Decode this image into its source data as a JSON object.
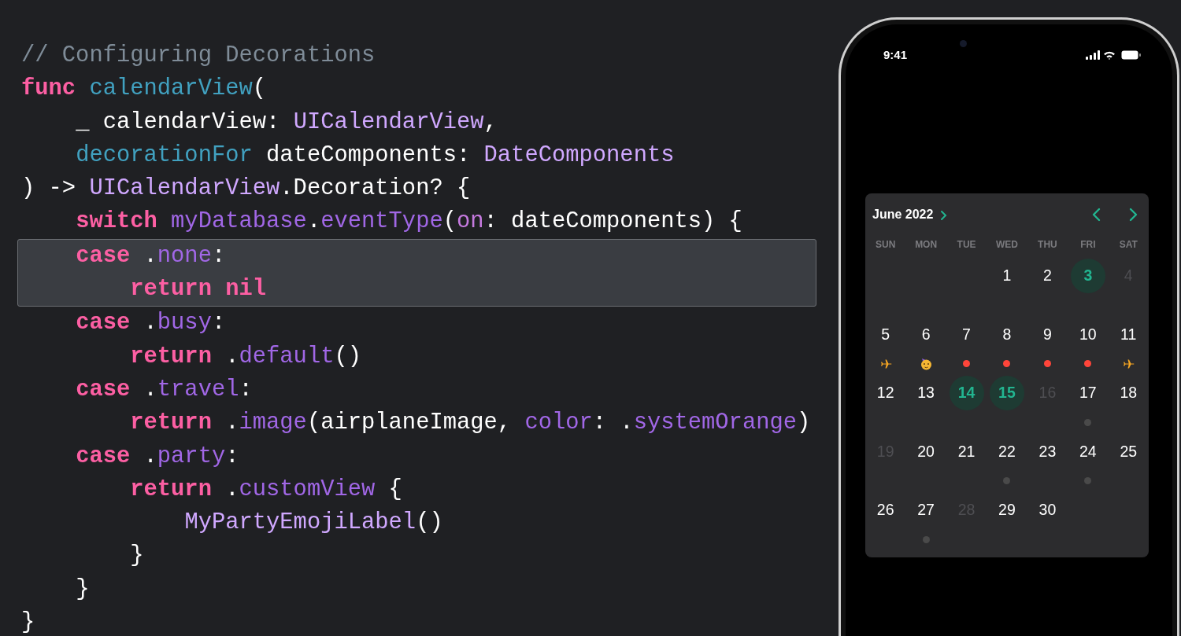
{
  "code": {
    "lines": [
      {
        "highlighted": false,
        "tokens": [
          {
            "kind": "comment",
            "text": "// Configuring Decorations"
          }
        ]
      },
      {
        "highlighted": false,
        "tokens": [
          {
            "kind": "keyword",
            "text": "func "
          },
          {
            "kind": "function",
            "text": "calendarView"
          },
          {
            "kind": "plain",
            "text": "("
          }
        ]
      },
      {
        "highlighted": false,
        "tokens": [
          {
            "kind": "plain",
            "text": "    _ calendarView: "
          },
          {
            "kind": "type",
            "text": "UICalendarView"
          },
          {
            "kind": "plain",
            "text": ","
          }
        ]
      },
      {
        "highlighted": false,
        "tokens": [
          {
            "kind": "function",
            "text": "    decorationFor"
          },
          {
            "kind": "plain",
            "text": " dateComponents: "
          },
          {
            "kind": "type",
            "text": "DateComponents"
          }
        ]
      },
      {
        "highlighted": false,
        "tokens": [
          {
            "kind": "plain",
            "text": ") -> "
          },
          {
            "kind": "type",
            "text": "UICalendarView"
          },
          {
            "kind": "plain",
            "text": ".Decoration? {"
          }
        ]
      },
      {
        "highlighted": false,
        "tokens": [
          {
            "kind": "keyword",
            "text": "    switch "
          },
          {
            "kind": "member",
            "text": "myDatabase"
          },
          {
            "kind": "plain",
            "text": "."
          },
          {
            "kind": "member",
            "text": "eventType"
          },
          {
            "kind": "plain",
            "text": "("
          },
          {
            "kind": "label",
            "text": "on"
          },
          {
            "kind": "plain",
            "text": ": dateComponents) {"
          }
        ]
      },
      {
        "highlighted": true,
        "tokens": [
          {
            "kind": "keyword",
            "text": "    case"
          },
          {
            "kind": "plain",
            "text": " ."
          },
          {
            "kind": "member",
            "text": "none"
          },
          {
            "kind": "plain",
            "text": ":"
          }
        ]
      },
      {
        "highlighted": true,
        "tokens": [
          {
            "kind": "keyword",
            "text": "        return nil"
          }
        ]
      },
      {
        "highlighted": false,
        "tokens": [
          {
            "kind": "keyword",
            "text": "    case"
          },
          {
            "kind": "plain",
            "text": " ."
          },
          {
            "kind": "member",
            "text": "busy"
          },
          {
            "kind": "plain",
            "text": ":"
          }
        ]
      },
      {
        "highlighted": false,
        "tokens": [
          {
            "kind": "keyword",
            "text": "        return"
          },
          {
            "kind": "plain",
            "text": " ."
          },
          {
            "kind": "member",
            "text": "default"
          },
          {
            "kind": "plain",
            "text": "()"
          }
        ]
      },
      {
        "highlighted": false,
        "tokens": [
          {
            "kind": "keyword",
            "text": "    case"
          },
          {
            "kind": "plain",
            "text": " ."
          },
          {
            "kind": "member",
            "text": "travel"
          },
          {
            "kind": "plain",
            "text": ":"
          }
        ]
      },
      {
        "highlighted": false,
        "tokens": [
          {
            "kind": "keyword",
            "text": "        return"
          },
          {
            "kind": "plain",
            "text": " ."
          },
          {
            "kind": "member",
            "text": "image"
          },
          {
            "kind": "plain",
            "text": "(airplaneImage, "
          },
          {
            "kind": "member",
            "text": "color"
          },
          {
            "kind": "plain",
            "text": ": ."
          },
          {
            "kind": "member",
            "text": "systemOrange"
          },
          {
            "kind": "plain",
            "text": ")"
          }
        ]
      },
      {
        "highlighted": false,
        "tokens": [
          {
            "kind": "keyword",
            "text": "    case"
          },
          {
            "kind": "plain",
            "text": " ."
          },
          {
            "kind": "member",
            "text": "party"
          },
          {
            "kind": "plain",
            "text": ":"
          }
        ]
      },
      {
        "highlighted": false,
        "tokens": [
          {
            "kind": "keyword",
            "text": "        return"
          },
          {
            "kind": "plain",
            "text": " ."
          },
          {
            "kind": "member",
            "text": "customView"
          },
          {
            "kind": "plain",
            "text": " {"
          }
        ]
      },
      {
        "highlighted": false,
        "tokens": [
          {
            "kind": "type",
            "text": "            MyPartyEmojiLabel"
          },
          {
            "kind": "plain",
            "text": "()"
          }
        ]
      },
      {
        "highlighted": false,
        "tokens": [
          {
            "kind": "plain",
            "text": "        }"
          }
        ]
      },
      {
        "highlighted": false,
        "tokens": [
          {
            "kind": "plain",
            "text": "    }"
          }
        ]
      },
      {
        "highlighted": false,
        "tokens": [
          {
            "kind": "plain",
            "text": "}"
          }
        ]
      }
    ]
  },
  "phone": {
    "status_bar": {
      "time": "9:41"
    },
    "calendar": {
      "month": "June 2022",
      "weekdays": [
        "SUN",
        "MON",
        "TUE",
        "WED",
        "THU",
        "FRI",
        "SAT"
      ],
      "weeks": [
        {
          "right_aligned": true,
          "days": [
            {
              "day": "1",
              "selected": false,
              "dimmed": false
            },
            {
              "day": "2",
              "selected": false,
              "dimmed": false
            },
            {
              "day": "3",
              "selected": true,
              "dimmed": false
            },
            {
              "day": "4",
              "selected": false,
              "dimmed": true
            }
          ]
        },
        {
          "days": [
            {
              "day": "5",
              "selected": false,
              "dimmed": false,
              "decoration": {
                "kind": "airplane",
                "color": "#f5a623"
              }
            },
            {
              "day": "6",
              "selected": false,
              "dimmed": false,
              "decoration": {
                "kind": "party"
              }
            },
            {
              "day": "7",
              "selected": false,
              "dimmed": false,
              "decoration": {
                "kind": "dot",
                "color": "#ff453a"
              }
            },
            {
              "day": "8",
              "selected": false,
              "dimmed": false,
              "decoration": {
                "kind": "dot",
                "color": "#ff453a"
              }
            },
            {
              "day": "9",
              "selected": false,
              "dimmed": false,
              "decoration": {
                "kind": "dot",
                "color": "#ff453a"
              }
            },
            {
              "day": "10",
              "selected": false,
              "dimmed": false,
              "decoration": {
                "kind": "dot",
                "color": "#ff453a"
              }
            },
            {
              "day": "11",
              "selected": false,
              "dimmed": false,
              "decoration": {
                "kind": "airplane",
                "color": "#f5a623"
              }
            }
          ]
        },
        {
          "days": [
            {
              "day": "12",
              "selected": false,
              "dimmed": false
            },
            {
              "day": "13",
              "selected": false,
              "dimmed": false
            },
            {
              "day": "14",
              "selected": true,
              "dimmed": false
            },
            {
              "day": "15",
              "selected": true,
              "dimmed": false
            },
            {
              "day": "16",
              "selected": false,
              "dimmed": true
            },
            {
              "day": "17",
              "selected": false,
              "dimmed": false,
              "decoration": {
                "kind": "dot",
                "color": "#4a4a4a"
              }
            },
            {
              "day": "18",
              "selected": false,
              "dimmed": false
            }
          ]
        },
        {
          "days": [
            {
              "day": "19",
              "selected": false,
              "dimmed": true
            },
            {
              "day": "20",
              "selected": false,
              "dimmed": false
            },
            {
              "day": "21",
              "selected": false,
              "dimmed": false
            },
            {
              "day": "22",
              "selected": false,
              "dimmed": false,
              "decoration": {
                "kind": "dot",
                "color": "#4a4a4a"
              }
            },
            {
              "day": "23",
              "selected": false,
              "dimmed": false
            },
            {
              "day": "24",
              "selected": false,
              "dimmed": false,
              "decoration": {
                "kind": "dot",
                "color": "#4a4a4a"
              }
            },
            {
              "day": "25",
              "selected": false,
              "dimmed": false
            }
          ]
        },
        {
          "days": [
            {
              "day": "26",
              "selected": false,
              "dimmed": false
            },
            {
              "day": "27",
              "selected": false,
              "dimmed": false,
              "decoration": {
                "kind": "dot",
                "color": "#4a4a4a"
              }
            },
            {
              "day": "28",
              "selected": false,
              "dimmed": true
            },
            {
              "day": "29",
              "selected": false,
              "dimmed": false
            },
            {
              "day": "30",
              "selected": false,
              "dimmed": false
            }
          ]
        }
      ]
    }
  }
}
